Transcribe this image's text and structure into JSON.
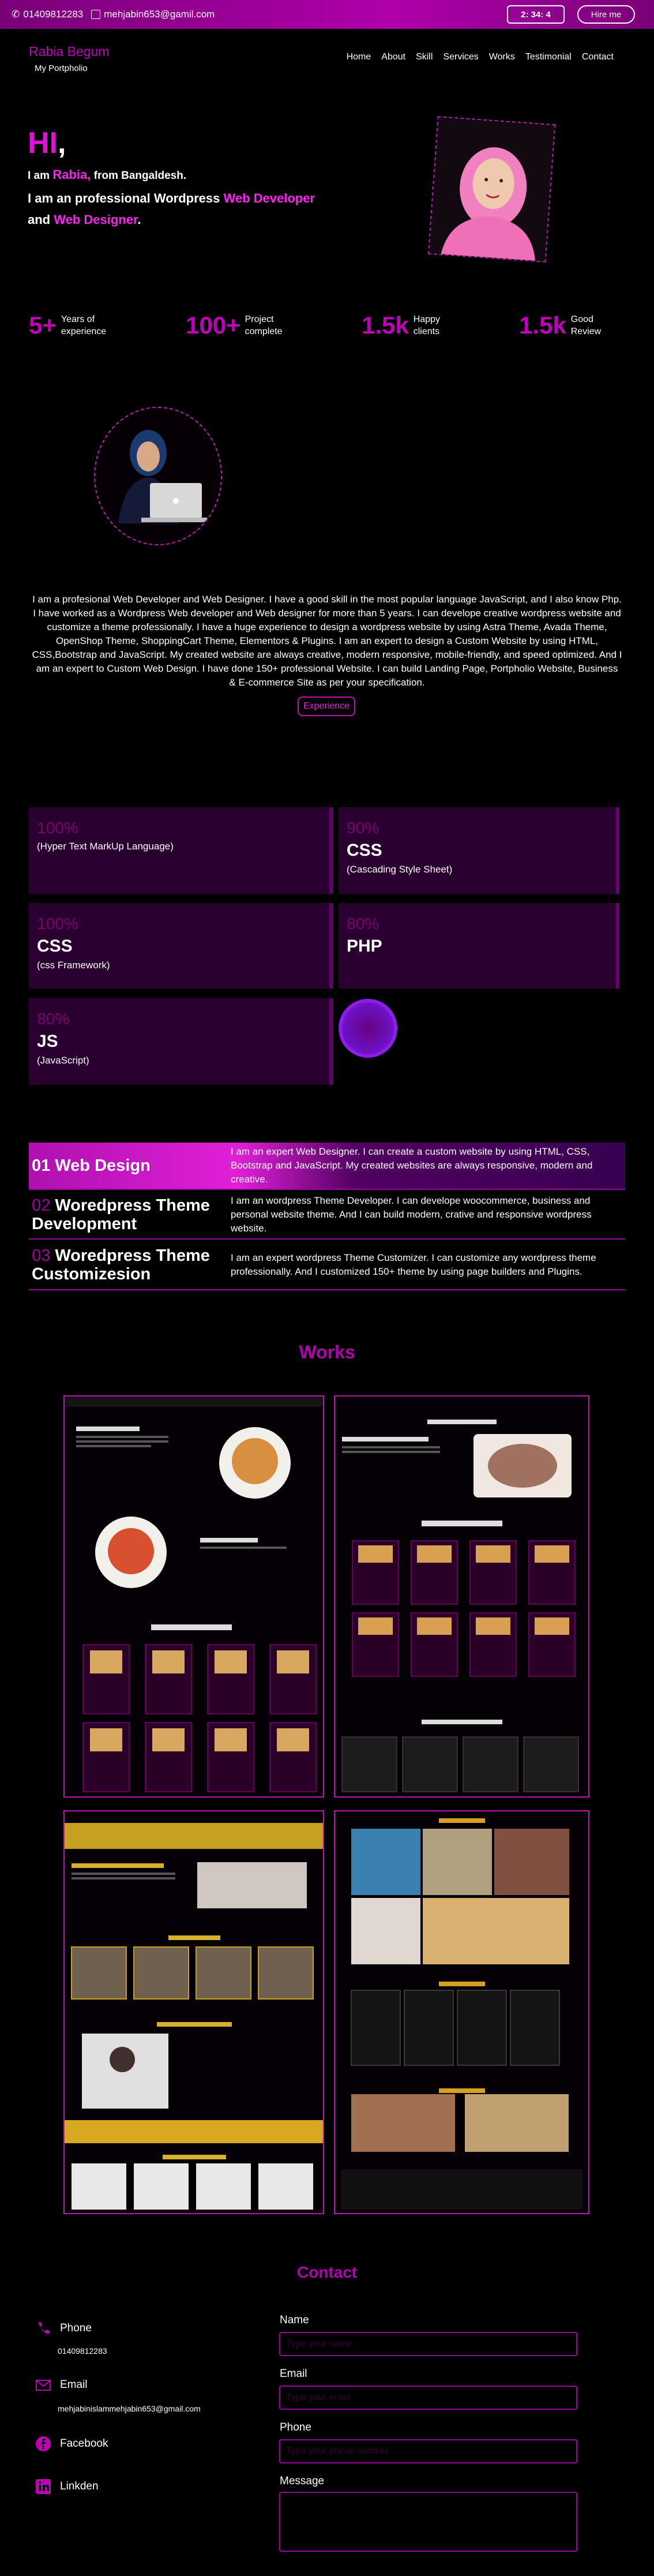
{
  "topbar": {
    "phone": "01409812283",
    "email": "mehjabin653@gamil.com",
    "clock": "2: 34: 4",
    "hire_label": "Hire me"
  },
  "brand": {
    "name": "Rabia Begum",
    "subtitle": "My Portpholio"
  },
  "nav": [
    "Home",
    "About",
    "Skill",
    "Services",
    "Works",
    "Testimonial",
    "Contact"
  ],
  "hero": {
    "hi": "HI",
    "hi_dot": ",",
    "line1_pre": "I am ",
    "line1_name": "Rabia,",
    "line1_post": " from Bangaldesh.",
    "line2_pre": "I am an professional Wordpress ",
    "line2_role1": "Web Developer",
    "line2_mid": " and ",
    "line2_role2": "Web Designer",
    "line2_post": "."
  },
  "stats": [
    {
      "num": "5+",
      "label1": "Years of",
      "label2": "experience"
    },
    {
      "num": "100+",
      "label1": "Project",
      "label2": "complete"
    },
    {
      "num": "1.5k",
      "label1": "Happy",
      "label2": "clients"
    },
    {
      "num": "1.5k",
      "label1": "Good",
      "label2": "Review"
    }
  ],
  "about": {
    "text": "I am a profesional Web Developer and Web Designer. I have a good skill in the most popular language JavaScript, and I also know Php. I have worked as a Wordpress Web developer and Web designer for more than 5 years. I can develope creative wordpress website and customize a theme professionally. I have a huge experience to design a wordpress website by using Astra Theme, Avada Theme, OpenShop Theme, ShoppingCart Theme, Elementors & Plugins. I am an expert to design a Custom Website by using HTML, CSS,Bootstrap and JavaScript. My created website are always creative, modern responsive, mobile-friendly, and speed optimized. And I am an expert to Custom Web Design. I have done 150+ professional Website. I can build Landing Page, Portpholio Website, Business & E-commerce Site as per your specification.",
    "button": "Experience"
  },
  "skills": [
    {
      "pct": "100%",
      "name": "",
      "desc": "(Hyper Text MarkUp Language)"
    },
    {
      "pct": "90%",
      "name": "CSS",
      "desc": "(Cascading Style Sheet)"
    },
    {
      "pct": "100%",
      "name": "CSS",
      "desc": "(css Framework)"
    },
    {
      "pct": "80%",
      "name": "PHP",
      "desc": ""
    },
    {
      "pct": "80%",
      "name": "JS",
      "desc": "(JavaScript)"
    }
  ],
  "services": [
    {
      "num": "01",
      "title": "Web Design",
      "desc": "I am an expert Web Designer. I can create a custom website by using HTML, CSS, Bootstrap and JavaScript. My created websites are always responsive, modern and creative."
    },
    {
      "num": "02",
      "title": "Woredpress Theme Development",
      "desc": "I am an wordpress Theme Developer. I can develope woocommerce, business and personal website theme. And I can build modern, crative and responsive wordpress website."
    },
    {
      "num": "03",
      "title": "Woredpress Theme Customizesion",
      "desc": "I am an expert wordpress Theme Customizer. I can customize any wordpress theme professionally. And I customized 150+ theme by using page builders and Plugins."
    }
  ],
  "works": {
    "heading": "Works"
  },
  "contact": {
    "heading": "Contact",
    "phone_label": "Phone",
    "phone_value": "01409812283",
    "email_label": "Email",
    "email_value": "mehjabinislammehjabin653@gmail.com",
    "facebook": "Facebook",
    "linkedin": "Linkden",
    "form": {
      "name": "Name",
      "name_ph": "Type your name",
      "email": "Email",
      "email_ph": "Type your email",
      "phone": "Phone",
      "phone_ph": "Type your phone number",
      "message": "Message"
    }
  },
  "colors": {
    "accent": "#c000b8",
    "panel": "#2a0030"
  }
}
